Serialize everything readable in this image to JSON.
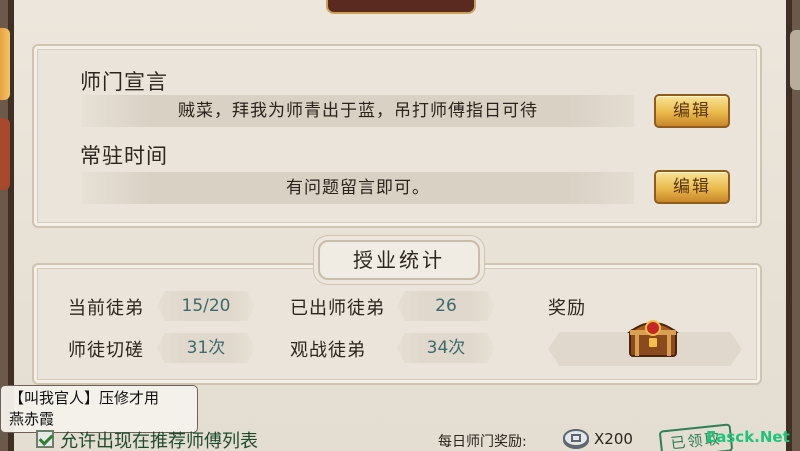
{
  "declaration": {
    "label": "师门宣言",
    "text": "贼菜，拜我为师青出于蓝，吊打师傅指日可待",
    "edit_label": "编辑"
  },
  "online_time": {
    "label": "常驻时间",
    "text": "有问题留言即可。",
    "edit_label": "编辑"
  },
  "stats": {
    "title": "授业统计",
    "current_disciples_label": "当前徒弟",
    "current_disciples_value": "15/20",
    "graduated_label": "已出师徒弟",
    "graduated_value": "26",
    "reward_label": "奖励",
    "sparring_label": "师徒切磋",
    "sparring_value": "31次",
    "spectate_label": "观战徒弟",
    "spectate_value": "34次"
  },
  "chat": {
    "line1": "【叫我官人】压修才用",
    "line2": "燕赤霞"
  },
  "bottom": {
    "recommend_text": "允许出现在推荐师傅列表",
    "daily_reward_label": "每日师门奖励:",
    "daily_reward_count": "X200",
    "claimed_stamp": "已领取"
  },
  "watermark": "Easck.Net",
  "colors": {
    "button_gold": "#eab94a",
    "stat_value_teal": "#3d6a6a",
    "stamp_green": "#2f7f55",
    "frame_brown": "#3f3024"
  }
}
